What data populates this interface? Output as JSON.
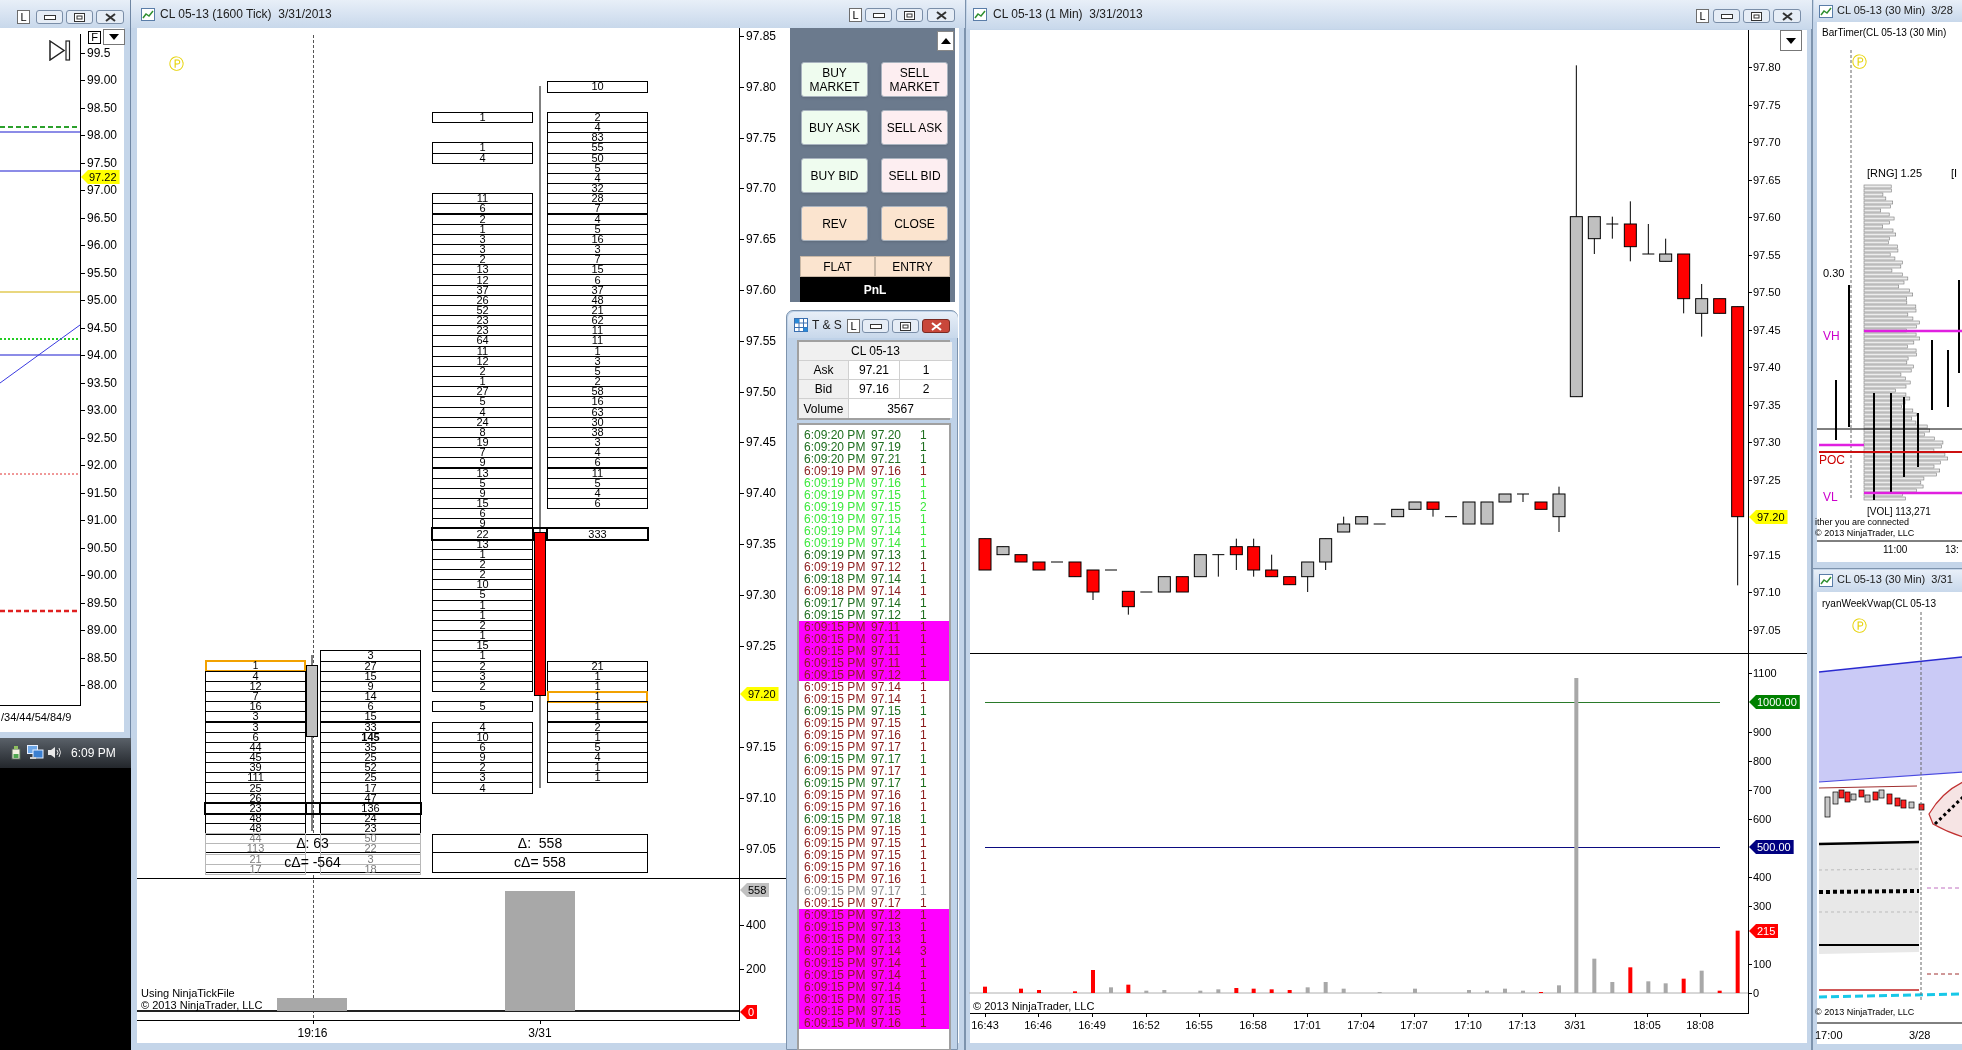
{
  "left_window": {
    "lock_button": "L",
    "f_button": "F",
    "price_axis": [
      "99.5",
      "99.00",
      "98.50",
      "98.00",
      "97.50",
      "97.00",
      "96.50",
      "96.00",
      "95.50",
      "95.00",
      "94.50",
      "94.00",
      "93.50",
      "93.00",
      "92.50",
      "92.00",
      "91.50",
      "91.00",
      "90.50",
      "90.00",
      "89.50",
      "89.00",
      "88.50",
      "88.00"
    ],
    "price_tag": "97.22",
    "time_axis": "/34/44/54/84/9"
  },
  "taskbar": {
    "clock": "6:09 PM"
  },
  "tick_chart": {
    "title": "CL 05-13 (1600 Tick)  3/31/2013",
    "lock_button": "L",
    "p_icon": "Ⓟ",
    "price_axis": [
      "97.85",
      "97.80",
      "97.75",
      "97.70",
      "97.65",
      "97.60",
      "97.55",
      "97.50",
      "97.45",
      "97.40",
      "97.35",
      "97.30",
      "97.25",
      "97.15",
      "97.10",
      "97.05"
    ],
    "price_tag": "97.20",
    "bars": [
      {
        "time_label": "19:16",
        "delta": "Δ: 63",
        "cumulative_delta": "cΔ= -564",
        "rows": [
          {
            "ask": "3",
            "kind": "plain"
          },
          {
            "bid": "1",
            "ask": "27",
            "kind": "bid_marked"
          },
          {
            "bid": "4",
            "ask": "15",
            "kind": "plain"
          },
          {
            "bid": "12",
            "ask": "9",
            "kind": "plain"
          },
          {
            "bid": "7",
            "ask": "14",
            "kind": "plain"
          },
          {
            "bid": "16",
            "ask": "6",
            "kind": "plain"
          },
          {
            "bid": "3",
            "ask": "15",
            "kind": "plain"
          },
          {
            "bid": "3",
            "ask": "33",
            "kind": "plain"
          },
          {
            "bid": "6",
            "ask": "145",
            "kind": "ask_bold"
          },
          {
            "bid": "44",
            "ask": "35",
            "kind": "plain"
          },
          {
            "bid": "45",
            "ask": "25",
            "kind": "plain"
          },
          {
            "bid": "39",
            "ask": "52",
            "kind": "plain"
          },
          {
            "bid": "111",
            "ask": "25",
            "kind": "plain"
          },
          {
            "bid": "25",
            "ask": "17",
            "kind": "plain"
          },
          {
            "bid": "26",
            "ask": "47",
            "kind": "plain"
          },
          {
            "bid": "23",
            "ask": "136",
            "kind": "poc"
          },
          {
            "bid": "48",
            "ask": "24",
            "kind": "plain"
          },
          {
            "bid": "48",
            "ask": "23",
            "kind": "plain"
          },
          {
            "bid": "44",
            "ask": "50",
            "kind": "faded"
          },
          {
            "bid": "113",
            "ask": "22",
            "kind": "faded"
          },
          {
            "bid": "21",
            "ask": "3",
            "kind": "faded"
          },
          {
            "bid": "17",
            "ask": "18",
            "kind": "faded"
          }
        ]
      },
      {
        "time_label": "3/31",
        "delta": "Δ:  558",
        "cumulative_delta": "cΔ= 558",
        "rows": [
          {
            "ask": "10",
            "kind": "plain"
          },
          {
            "kind": "empty"
          },
          {
            "kind": "empty"
          },
          {
            "bid": "1",
            "ask": "2",
            "kind": "plain"
          },
          {
            "ask": "4",
            "kind": "plain"
          },
          {
            "ask": "83",
            "kind": "plain"
          },
          {
            "bid": "1",
            "ask": "55",
            "kind": "plain"
          },
          {
            "bid": "4",
            "ask": "50",
            "kind": "plain"
          },
          {
            "ask": "5",
            "kind": "plain"
          },
          {
            "ask": "4",
            "kind": "plain"
          },
          {
            "ask": "32",
            "kind": "plain"
          },
          {
            "bid": "11",
            "ask": "28",
            "kind": "plain"
          },
          {
            "bid": "6",
            "ask": "7",
            "kind": "plain"
          },
          {
            "bid": "2",
            "ask": "4",
            "kind": "plain"
          },
          {
            "bid": "1",
            "ask": "5",
            "kind": "plain"
          },
          {
            "bid": "3",
            "ask": "16",
            "kind": "plain"
          },
          {
            "bid": "3",
            "ask": "3",
            "kind": "plain"
          },
          {
            "bid": "2",
            "ask": "7",
            "kind": "plain"
          },
          {
            "bid": "13",
            "ask": "15",
            "kind": "plain"
          },
          {
            "bid": "12",
            "ask": "6",
            "kind": "plain"
          },
          {
            "bid": "37",
            "ask": "37",
            "kind": "plain"
          },
          {
            "bid": "26",
            "ask": "48",
            "kind": "plain"
          },
          {
            "bid": "52",
            "ask": "21",
            "kind": "plain"
          },
          {
            "bid": "23",
            "ask": "62",
            "kind": "plain"
          },
          {
            "bid": "23",
            "ask": "11",
            "kind": "plain"
          },
          {
            "bid": "64",
            "ask": "11",
            "kind": "plain"
          },
          {
            "bid": "11",
            "ask": "1",
            "kind": "plain"
          },
          {
            "bid": "12",
            "ask": "3",
            "kind": "plain"
          },
          {
            "bid": "2",
            "ask": "5",
            "kind": "plain"
          },
          {
            "bid": "1",
            "ask": "2",
            "kind": "plain"
          },
          {
            "bid": "27",
            "ask": "58",
            "kind": "plain"
          },
          {
            "bid": "5",
            "ask": "16",
            "kind": "plain"
          },
          {
            "bid": "4",
            "ask": "63",
            "kind": "plain"
          },
          {
            "bid": "24",
            "ask": "30",
            "kind": "plain"
          },
          {
            "bid": "8",
            "ask": "38",
            "kind": "plain"
          },
          {
            "bid": "19",
            "ask": "3",
            "kind": "plain"
          },
          {
            "bid": "7",
            "ask": "4",
            "kind": "plain"
          },
          {
            "bid": "9",
            "ask": "6",
            "kind": "plain"
          },
          {
            "bid": "13",
            "ask": "11",
            "kind": "plain"
          },
          {
            "bid": "5",
            "ask": "5",
            "kind": "plain"
          },
          {
            "bid": "9",
            "ask": "4",
            "kind": "plain"
          },
          {
            "bid": "15",
            "ask": "6",
            "kind": "plain"
          },
          {
            "bid": "6",
            "kind": "plain"
          },
          {
            "bid": "9",
            "kind": "plain"
          },
          {
            "bid": "22",
            "ask": "333",
            "kind": "poc"
          },
          {
            "bid": "13",
            "kind": "plain"
          },
          {
            "bid": "1",
            "kind": "plain"
          },
          {
            "bid": "2",
            "kind": "plain"
          },
          {
            "bid": "2",
            "kind": "plain"
          },
          {
            "bid": "10",
            "kind": "plain"
          },
          {
            "bid": "5",
            "kind": "plain"
          },
          {
            "bid": "1",
            "kind": "plain"
          },
          {
            "bid": "1",
            "kind": "plain"
          },
          {
            "bid": "2",
            "kind": "plain"
          },
          {
            "bid": "1",
            "kind": "plain"
          },
          {
            "bid": "15",
            "kind": "plain"
          },
          {
            "bid": "1",
            "kind": "plain"
          },
          {
            "bid": "2",
            "ask": "21",
            "kind": "plain"
          },
          {
            "bid": "3",
            "ask": "1",
            "kind": "plain"
          },
          {
            "bid": "2",
            "ask": "1",
            "kind": "plain"
          },
          {
            "ask": "1",
            "kind": "ask_marked"
          },
          {
            "bid": "5",
            "ask": "1",
            "kind": "plain"
          },
          {
            "ask": "1",
            "kind": "plain"
          },
          {
            "bid": "4",
            "ask": "2",
            "kind": "plain"
          },
          {
            "bid": "10",
            "ask": "1",
            "kind": "plain"
          },
          {
            "bid": "6",
            "ask": "5",
            "kind": "plain"
          },
          {
            "bid": "9",
            "ask": "4",
            "kind": "plain"
          },
          {
            "bid": "2",
            "ask": "1",
            "kind": "plain"
          },
          {
            "bid": "3",
            "ask": "1",
            "kind": "plain"
          },
          {
            "bid": "4",
            "kind": "plain"
          }
        ]
      }
    ],
    "volume_axis": [
      "400",
      "200"
    ],
    "volume_tags": [
      {
        "text": "558",
        "color": "#c0c0c0"
      },
      {
        "text": "0",
        "color": "#ff0000"
      }
    ],
    "notes": [
      "Using NinjaTickFile",
      "© 2013 NinjaTrader, LLC"
    ]
  },
  "order_panel": {
    "buttons": [
      {
        "label": "BUY MARKET",
        "kind": "buy"
      },
      {
        "label": "SELL MARKET",
        "kind": "sell"
      },
      {
        "label": "BUY ASK",
        "kind": "buy"
      },
      {
        "label": "SELL ASK",
        "kind": "sell"
      },
      {
        "label": "BUY BID",
        "kind": "buy"
      },
      {
        "label": "SELL BID",
        "kind": "sell"
      },
      {
        "label": "REV",
        "kind": "action"
      },
      {
        "label": "CLOSE",
        "kind": "action"
      }
    ],
    "mode_buttons": [
      "FLAT",
      "ENTRY"
    ],
    "pnl": "PnL"
  },
  "time_and_sales": {
    "title": "T & S",
    "lock_button": "L",
    "instrument": "CL 05-13",
    "quotes": [
      {
        "label": "Ask",
        "price": "97.21",
        "size": "1"
      },
      {
        "label": "Bid",
        "price": "97.16",
        "size": "2"
      }
    ],
    "volume_label": "Volume",
    "volume": "3567",
    "trades": [
      {
        "time": "6:09:20 PM",
        "price": "97.20",
        "size": "1",
        "color": "#1e6e1e",
        "highlighted": false
      },
      {
        "time": "6:09:20 PM",
        "price": "97.19",
        "size": "1",
        "color": "#1e6e1e",
        "highlighted": false
      },
      {
        "time": "6:09:20 PM",
        "price": "97.21",
        "size": "1",
        "color": "#1e6e1e",
        "highlighted": false
      },
      {
        "time": "6:09:19 PM",
        "price": "97.16",
        "size": "1",
        "color": "#8b1c1c",
        "highlighted": false
      },
      {
        "time": "6:09:19 PM",
        "price": "97.16",
        "size": "1",
        "color": "#3ce83c",
        "highlighted": false
      },
      {
        "time": "6:09:19 PM",
        "price": "97.15",
        "size": "1",
        "color": "#3ce83c",
        "highlighted": false
      },
      {
        "time": "6:09:19 PM",
        "price": "97.15",
        "size": "2",
        "color": "#3ce83c",
        "highlighted": false
      },
      {
        "time": "6:09:19 PM",
        "price": "97.15",
        "size": "1",
        "color": "#3ce83c",
        "highlighted": false
      },
      {
        "time": "6:09:19 PM",
        "price": "97.14",
        "size": "1",
        "color": "#3ce83c",
        "highlighted": false
      },
      {
        "time": "6:09:19 PM",
        "price": "97.14",
        "size": "1",
        "color": "#3ce83c",
        "highlighted": false
      },
      {
        "time": "6:09:19 PM",
        "price": "97.13",
        "size": "1",
        "color": "#1e6e1e",
        "highlighted": false
      },
      {
        "time": "6:09:19 PM",
        "price": "97.12",
        "size": "1",
        "color": "#8b1c1c",
        "highlighted": false
      },
      {
        "time": "6:09:18 PM",
        "price": "97.14",
        "size": "1",
        "color": "#1e6e1e",
        "highlighted": false
      },
      {
        "time": "6:09:18 PM",
        "price": "97.14",
        "size": "1",
        "color": "#8b1c1c",
        "highlighted": false
      },
      {
        "time": "6:09:17 PM",
        "price": "97.14",
        "size": "1",
        "color": "#1e6e1e",
        "highlighted": false
      },
      {
        "time": "6:09:15 PM",
        "price": "97.12",
        "size": "1",
        "color": "#1e6e1e",
        "highlighted": false
      },
      {
        "time": "6:09:15 PM",
        "price": "97.11",
        "size": "1",
        "color": "#8b1c1c",
        "highlighted": true
      },
      {
        "time": "6:09:15 PM",
        "price": "97.11",
        "size": "1",
        "color": "#8b1c1c",
        "highlighted": true
      },
      {
        "time": "6:09:15 PM",
        "price": "97.11",
        "size": "1",
        "color": "#8b1c1c",
        "highlighted": true
      },
      {
        "time": "6:09:15 PM",
        "price": "97.11",
        "size": "1",
        "color": "#8b1c1c",
        "highlighted": true
      },
      {
        "time": "6:09:15 PM",
        "price": "97.12",
        "size": "1",
        "color": "#8b1c1c",
        "highlighted": true
      },
      {
        "time": "6:09:15 PM",
        "price": "97.14",
        "size": "1",
        "color": "#8b1c1c",
        "highlighted": false
      },
      {
        "time": "6:09:15 PM",
        "price": "97.14",
        "size": "1",
        "color": "#8b1c1c",
        "highlighted": false
      },
      {
        "time": "6:09:15 PM",
        "price": "97.15",
        "size": "1",
        "color": "#1e6e1e",
        "highlighted": false
      },
      {
        "time": "6:09:15 PM",
        "price": "97.15",
        "size": "1",
        "color": "#8b1c1c",
        "highlighted": false
      },
      {
        "time": "6:09:15 PM",
        "price": "97.16",
        "size": "1",
        "color": "#8b1c1c",
        "highlighted": false
      },
      {
        "time": "6:09:15 PM",
        "price": "97.17",
        "size": "1",
        "color": "#8b1c1c",
        "highlighted": false
      },
      {
        "time": "6:09:15 PM",
        "price": "97.17",
        "size": "1",
        "color": "#1e6e1e",
        "highlighted": false
      },
      {
        "time": "6:09:15 PM",
        "price": "97.17",
        "size": "1",
        "color": "#8b1c1c",
        "highlighted": false
      },
      {
        "time": "6:09:15 PM",
        "price": "97.17",
        "size": "1",
        "color": "#1e6e1e",
        "highlighted": false
      },
      {
        "time": "6:09:15 PM",
        "price": "97.16",
        "size": "1",
        "color": "#8b1c1c",
        "highlighted": false
      },
      {
        "time": "6:09:15 PM",
        "price": "97.16",
        "size": "1",
        "color": "#8b1c1c",
        "highlighted": false
      },
      {
        "time": "6:09:15 PM",
        "price": "97.18",
        "size": "1",
        "color": "#1e6e1e",
        "highlighted": false
      },
      {
        "time": "6:09:15 PM",
        "price": "97.15",
        "size": "1",
        "color": "#8b1c1c",
        "highlighted": false
      },
      {
        "time": "6:09:15 PM",
        "price": "97.15",
        "size": "1",
        "color": "#8b1c1c",
        "highlighted": false
      },
      {
        "time": "6:09:15 PM",
        "price": "97.15",
        "size": "1",
        "color": "#8b1c1c",
        "highlighted": false
      },
      {
        "time": "6:09:15 PM",
        "price": "97.16",
        "size": "1",
        "color": "#8b1c1c",
        "highlighted": false
      },
      {
        "time": "6:09:15 PM",
        "price": "97.16",
        "size": "1",
        "color": "#8b1c1c",
        "highlighted": false
      },
      {
        "time": "6:09:15 PM",
        "price": "97.17",
        "size": "1",
        "color": "#8a8a8a",
        "highlighted": false
      },
      {
        "time": "6:09:15 PM",
        "price": "97.17",
        "size": "1",
        "color": "#8b1c1c",
        "highlighted": false
      },
      {
        "time": "6:09:15 PM",
        "price": "97.12",
        "size": "1",
        "color": "#8b1c1c",
        "highlighted": true
      },
      {
        "time": "6:09:15 PM",
        "price": "97.13",
        "size": "1",
        "color": "#8b1c1c",
        "highlighted": true
      },
      {
        "time": "6:09:15 PM",
        "price": "97.13",
        "size": "1",
        "color": "#8b1c1c",
        "highlighted": true
      },
      {
        "time": "6:09:15 PM",
        "price": "97.14",
        "size": "3",
        "color": "#8b1c1c",
        "highlighted": true
      },
      {
        "time": "6:09:15 PM",
        "price": "97.14",
        "size": "1",
        "color": "#8b1c1c",
        "highlighted": true
      },
      {
        "time": "6:09:15 PM",
        "price": "97.14",
        "size": "1",
        "color": "#8b1c1c",
        "highlighted": true
      },
      {
        "time": "6:09:15 PM",
        "price": "97.14",
        "size": "1",
        "color": "#8b1c1c",
        "highlighted": true
      },
      {
        "time": "6:09:15 PM",
        "price": "97.15",
        "size": "1",
        "color": "#8b1c1c",
        "highlighted": true
      },
      {
        "time": "6:09:15 PM",
        "price": "97.15",
        "size": "1",
        "color": "#8b1c1c",
        "highlighted": true
      },
      {
        "time": "6:09:15 PM",
        "price": "97.16",
        "size": "1",
        "color": "#8b1c1c",
        "highlighted": true
      }
    ]
  },
  "minute_chart": {
    "title": "CL 05-13 (1 Min)  3/31/2013",
    "lock_button": "L",
    "price_axis": [
      "97.80",
      "97.75",
      "97.70",
      "97.65",
      "97.60",
      "97.55",
      "97.50",
      "97.45",
      "97.40",
      "97.35",
      "97.30",
      "97.25",
      "97.15",
      "97.10",
      "97.05"
    ],
    "volume_axis": [
      "1100",
      "900",
      "800",
      "700",
      "600",
      "400",
      "300",
      "100",
      "0"
    ],
    "tags": [
      {
        "text": "97.20",
        "color": "#ffff00"
      },
      {
        "text": "1000.00",
        "color": "#008000"
      },
      {
        "text": "500.00",
        "color": "#000080"
      },
      {
        "text": "215",
        "color": "#ff0000"
      }
    ],
    "time_axis": [
      "16:43",
      "16:46",
      "16:49",
      "16:52",
      "16:55",
      "16:58",
      "17:01",
      "17:04",
      "17:07",
      "17:10",
      "17:13",
      "3/31",
      "18:05",
      "18:08"
    ],
    "copyright": "© 2013 NinjaTrader, LLC"
  },
  "side_chart_top": {
    "title": "CL 05-13 (30 Min)  3/28",
    "indicator": "BarTimer(CL 05-13 (30 Min)",
    "p_icon": "Ⓟ",
    "labels": [
      "[RNG] 1.25",
      "[I",
      "0.30",
      "[VOL] 113,271",
      "ither you are connected"
    ],
    "level_labels": [
      {
        "text": "VH",
        "color": "#cc00cc"
      },
      {
        "text": "POC",
        "color": "#cc0000"
      },
      {
        "text": "VL",
        "color": "#cc00cc"
      }
    ],
    "copyright": "© 2013 NinjaTrader, LLC",
    "time_axis": [
      "11:00",
      "13:"
    ]
  },
  "side_chart_bottom": {
    "title": "CL 05-13 (30 Min)  3/31",
    "indicator": "ryanWeekVwap(CL 05-13",
    "p_icon": "Ⓟ",
    "copyright": "© 2013 NinjaTrader, LLC",
    "time_axis": [
      "17:00",
      "3/28"
    ]
  }
}
